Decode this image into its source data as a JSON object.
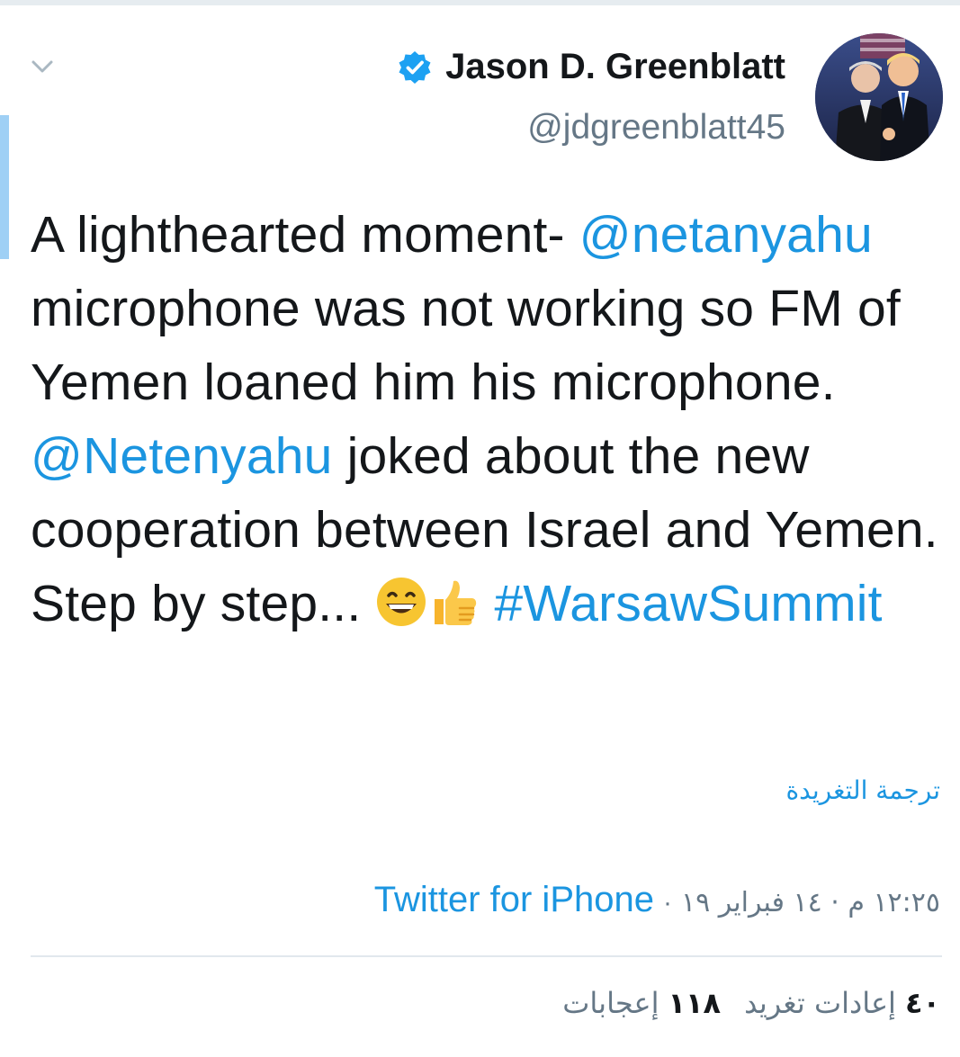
{
  "tweet": {
    "author": {
      "display_name": "Jason D. Greenblatt",
      "handle": "@jdgreenblatt45"
    },
    "text_parts": {
      "p1": "A lighthearted moment- ",
      "mention1": "@netanyahu",
      "p2": " microphone was not working so FM of Yemen loaned him his microphone. ",
      "mention2": "@Netenyahu",
      "p3": " joked about the new cooperation between Israel and Yemen. Step by step... ",
      "hashtag": "#WarsawSummit"
    },
    "translate_label": "ترجمة التغريدة",
    "timestamp": "١٢:٢٥ م · ١٤ فبراير ١٩",
    "separator": "·",
    "source": "Twitter for iPhone",
    "stats": {
      "retweets_count": "٤٠",
      "retweets_label": "إعادات تغريد",
      "likes_count": "١١٨",
      "likes_label": "إعجابات"
    }
  },
  "icons": {
    "caret": "chevron-down-icon",
    "verified": "verified-badge-icon",
    "emoji1": "grinning-face-emoji",
    "emoji2": "thumbs-up-emoji"
  },
  "colors": {
    "link": "#1b95e0",
    "secondary_text": "#657786",
    "primary_text": "#14171a",
    "accent_bar": "#9fd0f5"
  }
}
